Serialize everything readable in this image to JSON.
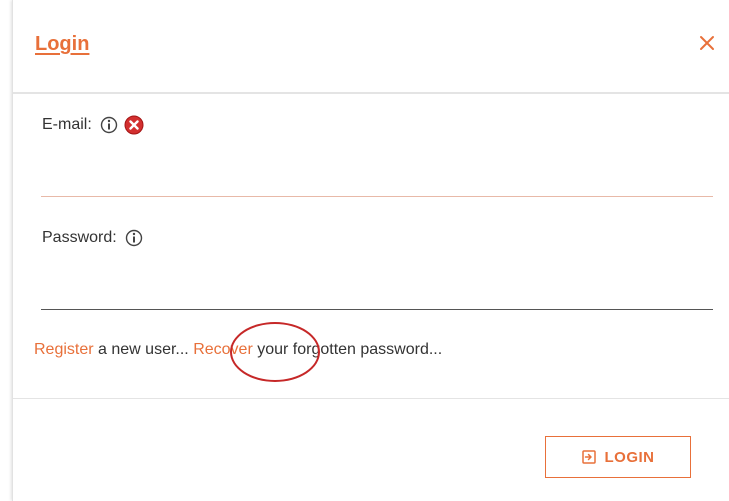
{
  "dialog": {
    "title": "Login",
    "close_icon": "close-icon"
  },
  "form": {
    "email": {
      "label": "E-mail:",
      "value": "",
      "info_icon": "info-icon",
      "error_icon": "error-icon"
    },
    "password": {
      "label": "Password:",
      "value": "",
      "info_icon": "info-icon"
    }
  },
  "links": {
    "register": "Register",
    "register_suffix": " a new user... ",
    "recover": "Recover",
    "recover_suffix": " your forgotten password..."
  },
  "footer": {
    "login_label": "LOGIN",
    "login_icon": "login-icon"
  },
  "colors": {
    "accent": "#e8703a",
    "error": "#c62828",
    "annotation_circle": "#c62828"
  }
}
